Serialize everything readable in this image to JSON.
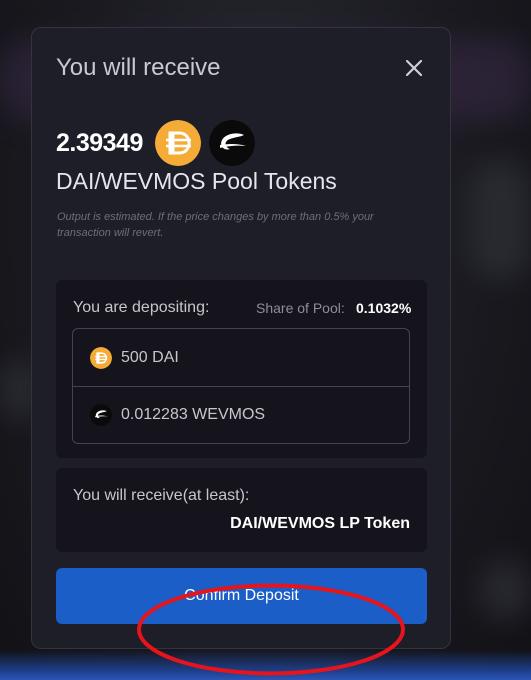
{
  "modal": {
    "title": "You will receive",
    "close_icon": "close-icon",
    "amount": "2.39349",
    "token_a_icon": "dai-icon",
    "token_b_icon": "wevmos-icon",
    "pool_name": "DAI/WEVMOS Pool Tokens",
    "disclaimer": "Output is estimated. If the price changes by more than 0.5% your transaction will revert."
  },
  "deposit": {
    "label": "You are depositing:",
    "share_label": "Share of Pool:",
    "share_value": "0.1032%",
    "assets": [
      {
        "icon": "dai-icon",
        "text": "500 DAI"
      },
      {
        "icon": "wevmos-icon",
        "text": "0.012283 WEVMOS"
      }
    ]
  },
  "receive": {
    "label": "You will receive(at least):",
    "token": "DAI/WEVMOS LP Token"
  },
  "confirm": {
    "label": "Confirm Deposit"
  },
  "colors": {
    "accent": "#1b5ec8",
    "dai": "#f5ac37",
    "highlight": "#e8141b"
  }
}
